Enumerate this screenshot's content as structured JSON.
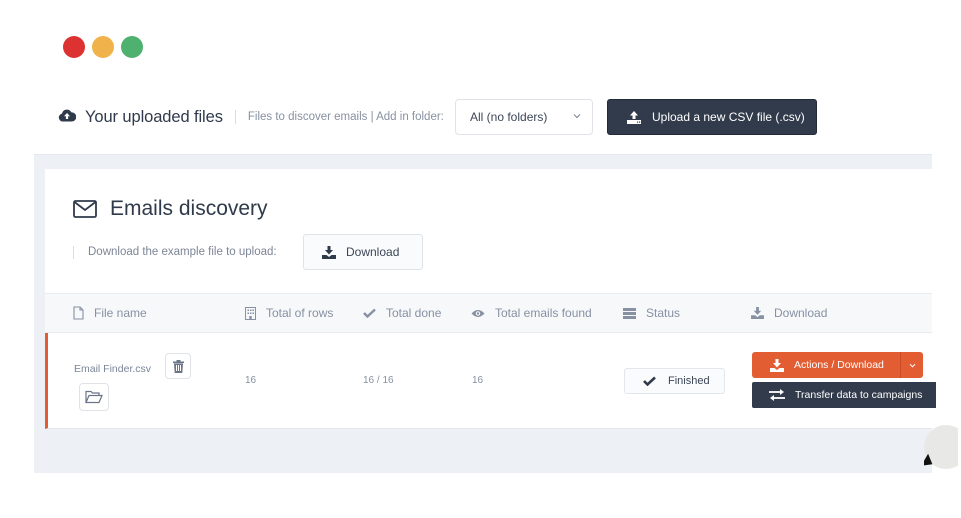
{
  "window": {
    "controls": [
      {
        "name": "close",
        "color": "#dc3232"
      },
      {
        "name": "minimize",
        "color": "#f0b34b"
      },
      {
        "name": "maximize",
        "color": "#4fb16f"
      }
    ]
  },
  "header": {
    "icon": "cloud-upload-icon",
    "title": "Your uploaded files",
    "subtitle": "Files to discover emails | Add in folder:",
    "folder_select": {
      "value": "All (no folders)",
      "icon": "chevron-down-icon"
    },
    "upload_button": {
      "label": "Upload a new CSV file (.csv)",
      "icon": "upload-icon"
    }
  },
  "card": {
    "icon": "envelope-icon",
    "title": "Emails discovery",
    "example_label": "Download the example file to upload:",
    "example_button": {
      "label": "Download",
      "icon": "download-icon"
    }
  },
  "table": {
    "columns": [
      {
        "label": "File name",
        "icon": "file-icon"
      },
      {
        "label": "Total of rows",
        "icon": "building-icon"
      },
      {
        "label": "Total done",
        "icon": "check-icon"
      },
      {
        "label": "Total emails found",
        "icon": "eye-icon"
      },
      {
        "label": "Status",
        "icon": "server-icon"
      },
      {
        "label": "Download",
        "icon": "download-icon"
      }
    ],
    "rows": [
      {
        "file_name": "Email Finder.csv",
        "total_rows": "16",
        "total_done": "16 / 16",
        "emails_found": "16",
        "status": "Finished",
        "actions_label": "Actions / Download",
        "transfer_label": "Transfer data to campaigns"
      }
    ]
  },
  "colors": {
    "accent": "#e35d33",
    "dark_button": "#323b4b",
    "panel_bg": "#edf1f5"
  }
}
